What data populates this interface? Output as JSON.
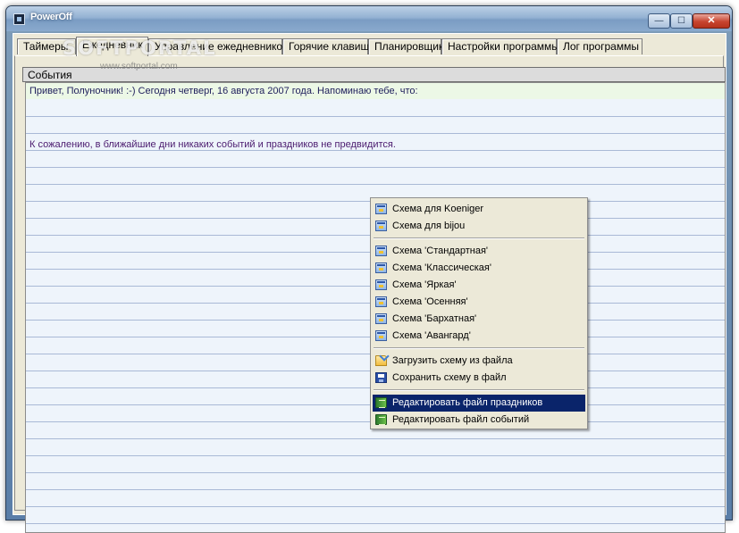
{
  "window": {
    "title": "PowerOff",
    "controls": {
      "minimize": "—",
      "maximize": "☐",
      "close": "✕"
    }
  },
  "watermark": {
    "text": "SOFTPORTAL",
    "url": "www.softportal.com"
  },
  "tabs": [
    {
      "label": "Таймеры"
    },
    {
      "label": "Ежедневник",
      "active": true
    },
    {
      "label": "Управление ежедневником"
    },
    {
      "label": "Горячие клавиши"
    },
    {
      "label": "Планировщик"
    },
    {
      "label": "Настройки программы"
    },
    {
      "label": "Лог программы"
    }
  ],
  "section": {
    "title": "События"
  },
  "notes": {
    "greeting": "Привет, Полуночник! :-)  Сегодня четверг, 16 августа 2007 года.  Напоминаю тебе, что:",
    "message": "К сожалению, в ближайшие дни никаких событий и праздников не предвидится."
  },
  "context_menu": {
    "items": [
      {
        "label": "Схема для Koeniger",
        "icon": "scheme-icon"
      },
      {
        "label": "Схема для bijou",
        "icon": "scheme-icon"
      },
      {
        "label": "Схема 'Стандартная'",
        "icon": "scheme-icon"
      },
      {
        "label": "Схема 'Классическая'",
        "icon": "scheme-icon"
      },
      {
        "label": "Схема 'Яркая'",
        "icon": "scheme-icon"
      },
      {
        "label": "Схема 'Осенняя'",
        "icon": "scheme-icon"
      },
      {
        "label": "Схема 'Бархатная'",
        "icon": "scheme-icon"
      },
      {
        "label": "Схема 'Авангард'",
        "icon": "scheme-icon"
      },
      {
        "label": "Загрузить схему из файла",
        "icon": "open-folder-icon"
      },
      {
        "label": "Сохранить схему в файл",
        "icon": "save-icon"
      },
      {
        "label": "Редактировать файл праздников",
        "icon": "book-icon",
        "highlighted": true
      },
      {
        "label": "Редактировать файл событий",
        "icon": "book-icon"
      }
    ]
  },
  "colors": {
    "menu_highlight": "#0a246a",
    "greeting_row_bg": "#ecf8e6",
    "note_lines": "#a9b9d6",
    "message_text": "#4a1a6e"
  }
}
